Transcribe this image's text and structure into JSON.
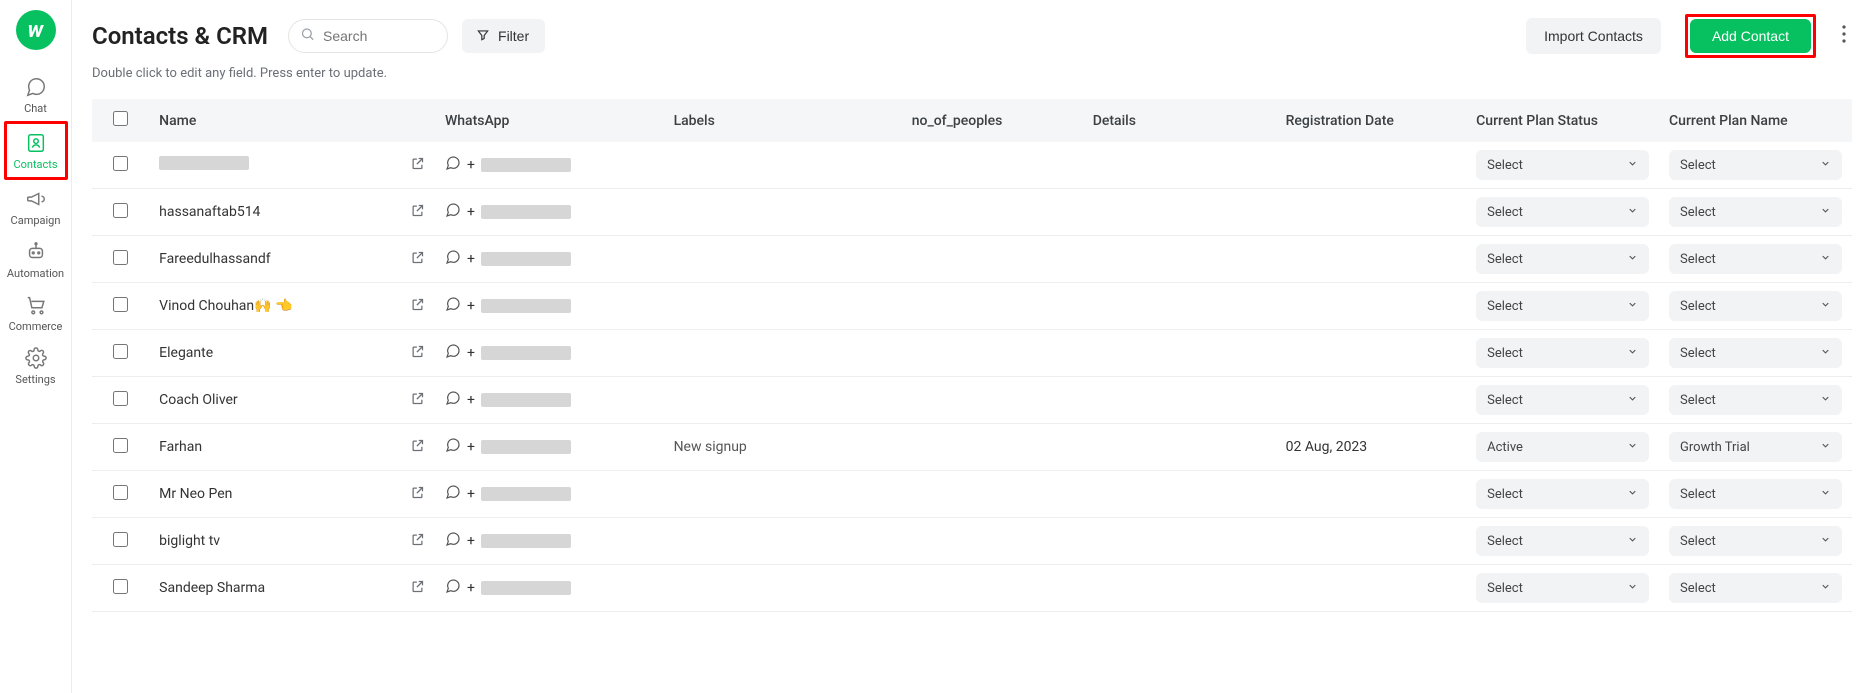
{
  "sidebar": {
    "items": [
      {
        "label": "Chat"
      },
      {
        "label": "Contacts"
      },
      {
        "label": "Campaign"
      },
      {
        "label": "Automation"
      },
      {
        "label": "Commerce"
      },
      {
        "label": "Settings"
      }
    ]
  },
  "header": {
    "title": "Contacts & CRM",
    "search_placeholder": "Search",
    "filter_label": "Filter",
    "import_label": "Import Contacts",
    "add_label": "Add Contact",
    "hint": "Double click to edit any field. Press enter to update."
  },
  "columns": {
    "name": "Name",
    "whatsapp": "WhatsApp",
    "labels": "Labels",
    "no_of_peoples": "no_of_peoples",
    "details": "Details",
    "registration_date": "Registration Date",
    "current_plan_status": "Current Plan Status",
    "current_plan_name": "Current Plan Name"
  },
  "defaults": {
    "select_label": "Select",
    "phone_prefix": "+"
  },
  "rows": [
    {
      "name": "",
      "redacted": true,
      "labels": "",
      "no_of_peoples": "",
      "details": "",
      "registration_date": "",
      "status": "Select",
      "plan": "Select"
    },
    {
      "name": "hassanaftab514",
      "redacted": false,
      "labels": "",
      "no_of_peoples": "",
      "details": "",
      "registration_date": "",
      "status": "Select",
      "plan": "Select"
    },
    {
      "name": "Fareedulhassandf",
      "redacted": false,
      "labels": "",
      "no_of_peoples": "",
      "details": "",
      "registration_date": "",
      "status": "Select",
      "plan": "Select"
    },
    {
      "name": "Vinod Chouhan🙌 👈",
      "redacted": false,
      "labels": "",
      "no_of_peoples": "",
      "details": "",
      "registration_date": "",
      "status": "Select",
      "plan": "Select"
    },
    {
      "name": "Elegante",
      "redacted": false,
      "labels": "",
      "no_of_peoples": "",
      "details": "",
      "registration_date": "",
      "status": "Select",
      "plan": "Select"
    },
    {
      "name": "Coach Oliver",
      "redacted": false,
      "labels": "",
      "no_of_peoples": "",
      "details": "",
      "registration_date": "",
      "status": "Select",
      "plan": "Select"
    },
    {
      "name": "Farhan",
      "redacted": false,
      "labels": "New signup",
      "no_of_peoples": "",
      "details": "",
      "registration_date": "02 Aug, 2023",
      "status": "Active",
      "plan": "Growth Trial"
    },
    {
      "name": "Mr Neo Pen",
      "redacted": false,
      "labels": "",
      "no_of_peoples": "",
      "details": "",
      "registration_date": "",
      "status": "Select",
      "plan": "Select"
    },
    {
      "name": "biglight tv",
      "redacted": false,
      "labels": "",
      "no_of_peoples": "",
      "details": "",
      "registration_date": "",
      "status": "Select",
      "plan": "Select"
    },
    {
      "name": "Sandeep Sharma",
      "redacted": false,
      "labels": "",
      "no_of_peoples": "",
      "details": "",
      "registration_date": "",
      "status": "Select",
      "plan": "Select"
    }
  ]
}
